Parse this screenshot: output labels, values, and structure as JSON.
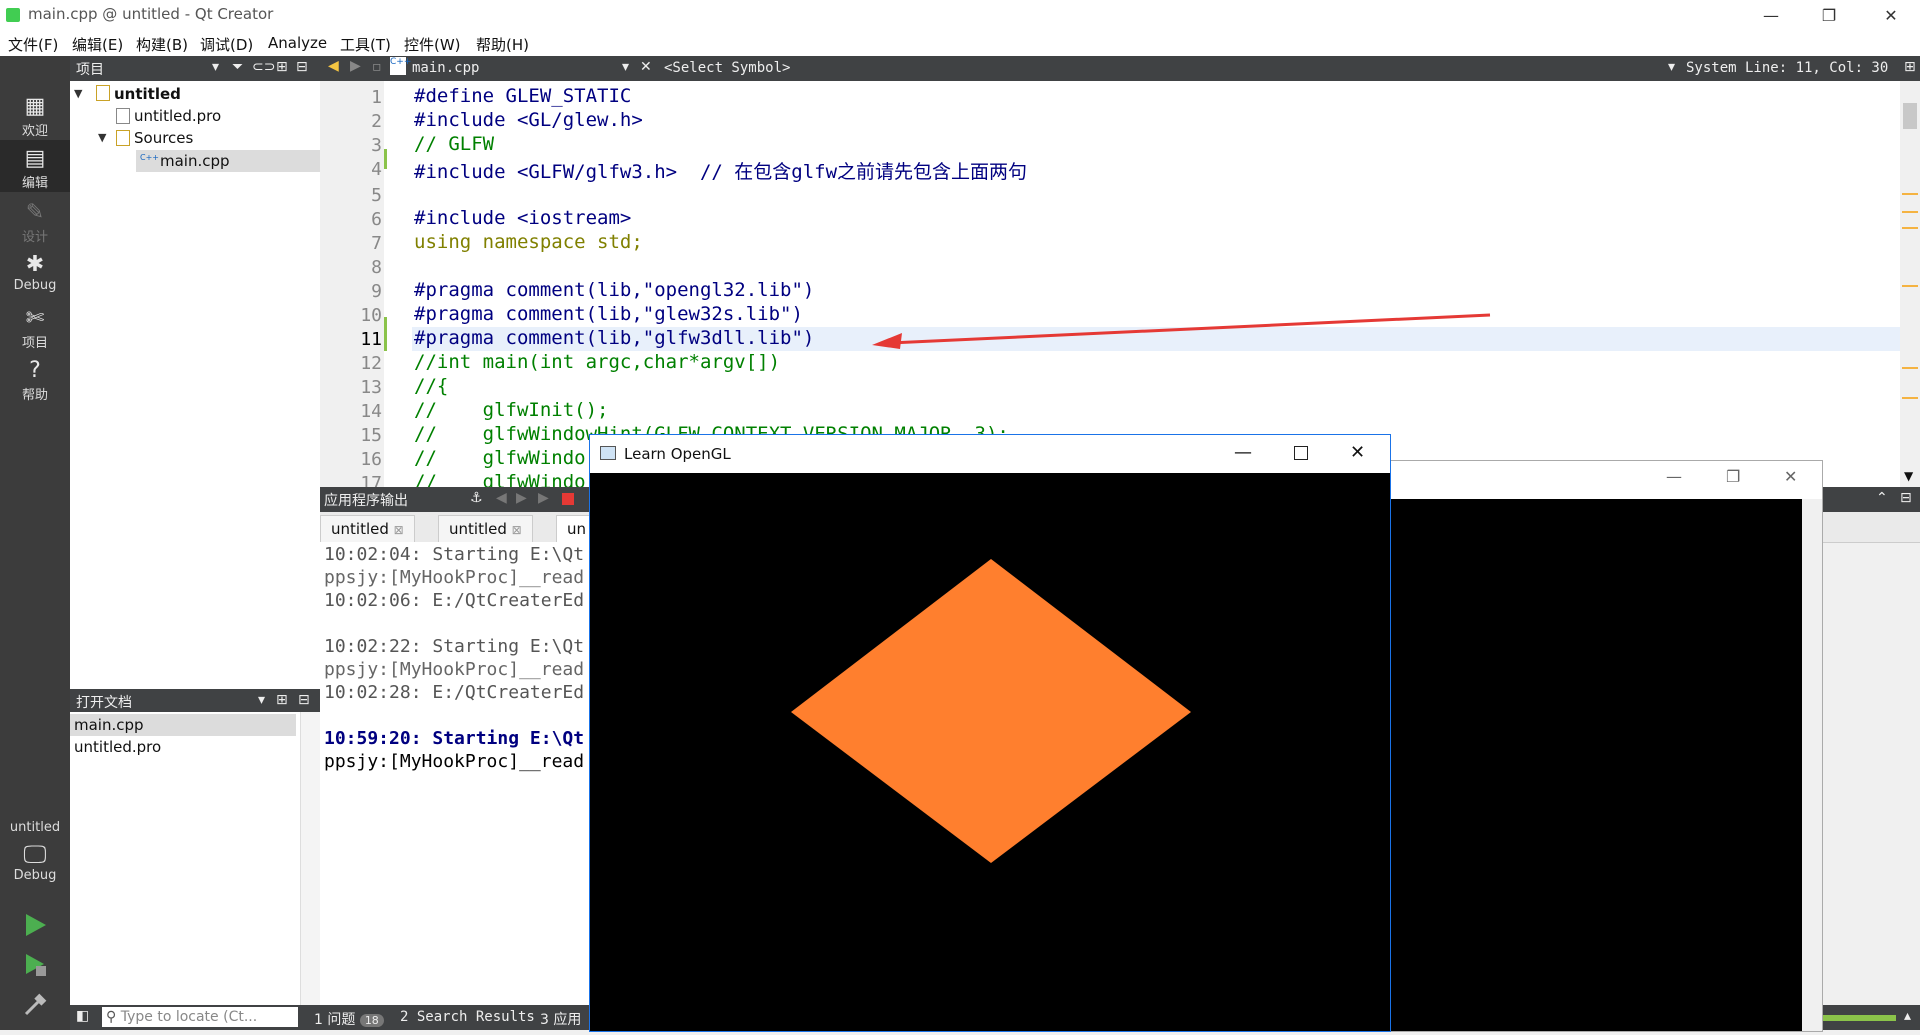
{
  "window": {
    "title": "main.cpp @ untitled - Qt Creator",
    "minimize": "—",
    "restore": "❐",
    "close": "✕"
  },
  "menu": [
    "文件(F)",
    "编辑(E)",
    "构建(B)",
    "调试(D)",
    "Analyze",
    "工具(T)",
    "控件(W)",
    "帮助(H)"
  ],
  "modes": [
    {
      "label": "欢迎",
      "icon": "grid-icon"
    },
    {
      "label": "编辑",
      "icon": "edit-icon"
    },
    {
      "label": "设计",
      "icon": "pencil-icon"
    },
    {
      "label": "Debug",
      "icon": "bug-icon"
    },
    {
      "label": "项目",
      "icon": "wrench-icon"
    },
    {
      "label": "帮助",
      "icon": "help-icon"
    }
  ],
  "kit": {
    "project": "untitled",
    "config": "Debug"
  },
  "project_panel": {
    "title": "项目",
    "tree": [
      "untitled",
      "untitled.pro",
      "Sources",
      "main.cpp"
    ]
  },
  "editor": {
    "file": "main.cpp",
    "symbol": "<Select Symbol>",
    "position": "System Line: 11, Col: 30",
    "lines": [
      {
        "n": "1",
        "text": "#define GLEW_STATIC"
      },
      {
        "n": "2",
        "text": "#include <GL/glew.h>"
      },
      {
        "n": "3",
        "text": "// GLFW"
      },
      {
        "n": "4",
        "text": "#include <GLFW/glfw3.h>  // 在包含glfw之前请先包含上面两句"
      },
      {
        "n": "5",
        "text": ""
      },
      {
        "n": "6",
        "text": "#include <iostream>"
      },
      {
        "n": "7",
        "text": "using namespace std;"
      },
      {
        "n": "8",
        "text": ""
      },
      {
        "n": "9",
        "text": "#pragma comment(lib,\"opengl32.lib\")"
      },
      {
        "n": "10",
        "text": "#pragma comment(lib,\"glew32s.lib\")"
      },
      {
        "n": "11",
        "text": "#pragma comment(lib,\"glfw3dll.lib\")"
      },
      {
        "n": "12",
        "text": "//int main(int argc,char*argv[])"
      },
      {
        "n": "13",
        "text": "//{"
      },
      {
        "n": "14",
        "text": "//    glfwInit();"
      },
      {
        "n": "15",
        "text": "//    glfwWindowHint(GLFW_CONTEXT_VERSION_MAJOR, 3);"
      },
      {
        "n": "16",
        "text": "//    glfwWindo"
      },
      {
        "n": "17",
        "text": "//    glfwWindo"
      }
    ]
  },
  "output": {
    "title": "应用程序输出",
    "tabs": [
      "untitled",
      "untitled",
      "un"
    ],
    "lines": [
      "10:02:04: Starting E:\\Qt",
      "ppsjy:[MyHookProc]__read",
      "10:02:06: E:/QtCreaterEd",
      "",
      "10:02:22: Starting E:\\Qt",
      "ppsjy:[MyHookProc]__read",
      "10:02:28: E:/QtCreaterEd",
      "",
      "10:59:20: Starting E:\\Qt",
      "ppsjy:[MyHookProc]__read"
    ]
  },
  "open_docs": {
    "title": "打开文档",
    "items": [
      "main.cpp",
      "untitled.pro"
    ]
  },
  "status": {
    "locate_placeholder": "Type to locate (Ct...",
    "issues_label": "1 问题",
    "issues_count": "18",
    "search_results": "2 Search Results",
    "app_output": "3 应用"
  },
  "gl_window": {
    "title": "Learn OpenGL",
    "shape_color": "#ff7f2e"
  },
  "annotation_arrow_color": "#e53935"
}
